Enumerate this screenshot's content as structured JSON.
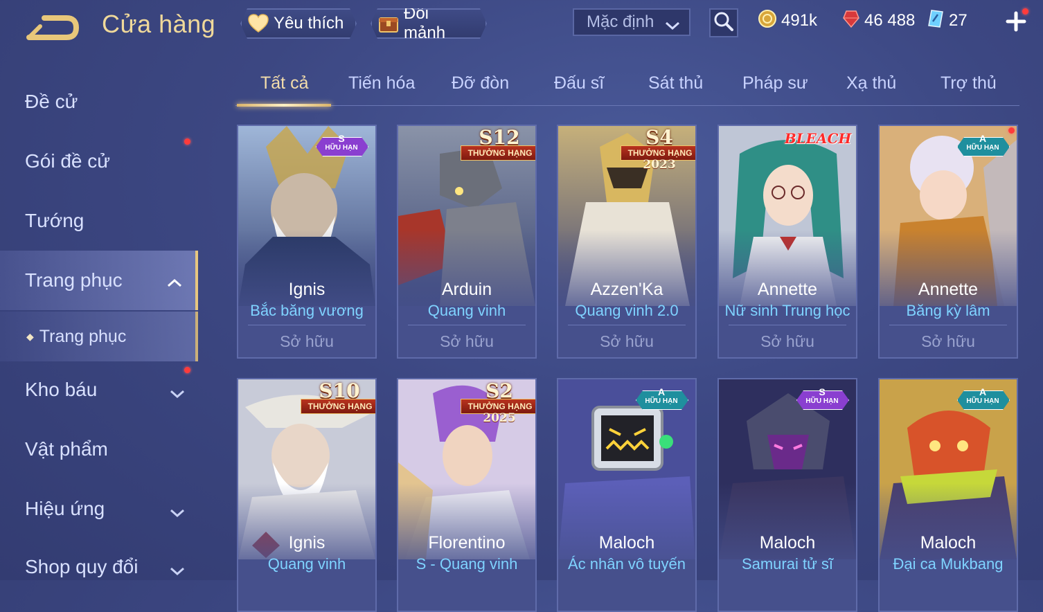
{
  "header": {
    "title": "Cửa hàng",
    "favorites_label": "Yêu thích",
    "exchange_label": "Đổi mảnh",
    "sort_value": "Mặc định",
    "gold": "491k",
    "ruby": "46 488",
    "voucher": "27"
  },
  "sidebar": {
    "items": [
      {
        "label": "Đề cử"
      },
      {
        "label": "Gói đề cử"
      },
      {
        "label": "Tướng"
      },
      {
        "label": "Trang phục"
      },
      {
        "label": "Trang phục"
      },
      {
        "label": "Kho báu"
      },
      {
        "label": "Vật phẩm"
      },
      {
        "label": "Hiệu ứng"
      },
      {
        "label": "Shop quy đổi"
      }
    ]
  },
  "tabs": [
    {
      "label": "Tất cả"
    },
    {
      "label": "Tiến hóa"
    },
    {
      "label": "Đỡ đòn"
    },
    {
      "label": "Đấu sĩ"
    },
    {
      "label": "Sát thủ"
    },
    {
      "label": "Pháp sư"
    },
    {
      "label": "Xạ thủ"
    },
    {
      "label": "Trợ thủ"
    }
  ],
  "cards": [
    {
      "hero": "Ignis",
      "skin": "Bắc băng vương",
      "status": "Sở hữu",
      "badge_tier": "S",
      "badge_label": "HỮU HẠN"
    },
    {
      "hero": "Arduin",
      "skin": "Quang vinh",
      "status": "Sở hữu",
      "badge_season": "S12",
      "badge_ribbon": "THƯỞNG HẠNG"
    },
    {
      "hero": "Azzen'Ka",
      "skin": "Quang vinh 2.0",
      "status": "Sở hữu",
      "badge_season": "S4",
      "badge_ribbon": "THƯỞNG HẠNG",
      "badge_year": "2023"
    },
    {
      "hero": "Annette",
      "skin": "Nữ sinh Trung học",
      "status": "Sở hữu",
      "badge_collab": "BLEACH"
    },
    {
      "hero": "Annette",
      "skin": "Băng kỳ lâm",
      "status": "Sở hữu",
      "badge_tier": "A",
      "badge_label": "HỮU HẠN"
    },
    {
      "hero": "Ignis",
      "skin": "Quang vinh",
      "badge_season": "S10",
      "badge_ribbon": "THƯỞNG HẠNG"
    },
    {
      "hero": "Florentino",
      "skin": "S - Quang vinh",
      "badge_season": "S2",
      "badge_ribbon": "THƯỞNG HẠNG",
      "badge_year": "2025"
    },
    {
      "hero": "Maloch",
      "skin": "Ác nhân vô tuyến",
      "badge_tier": "A",
      "badge_label": "HỮU HẠN"
    },
    {
      "hero": "Maloch",
      "skin": "Samurai tử sĩ",
      "badge_tier": "S",
      "badge_label": "HỮU HẠN"
    },
    {
      "hero": "Maloch",
      "skin": "Đại ca Mukbang",
      "badge_tier": "A",
      "badge_label": "HỮU HẠN"
    }
  ],
  "colors": {
    "background": "#3c4782",
    "title_gold": "#f0d99a",
    "skin_name_blue": "#7fd3ff",
    "notification_red": "#ff3b3b",
    "tier_s_purple": "#8a3fd0",
    "tier_a_teal": "#1f8f9e"
  },
  "icons": {
    "back": "back-arrow-icon",
    "favorites": "heart-icon",
    "exchange": "treasure-box-icon",
    "sort": "chevron-down-icon",
    "search": "search-icon",
    "gold": "gold-coin-icon",
    "ruby": "ruby-gem-icon",
    "voucher": "voucher-icon",
    "add": "plus-icon"
  }
}
